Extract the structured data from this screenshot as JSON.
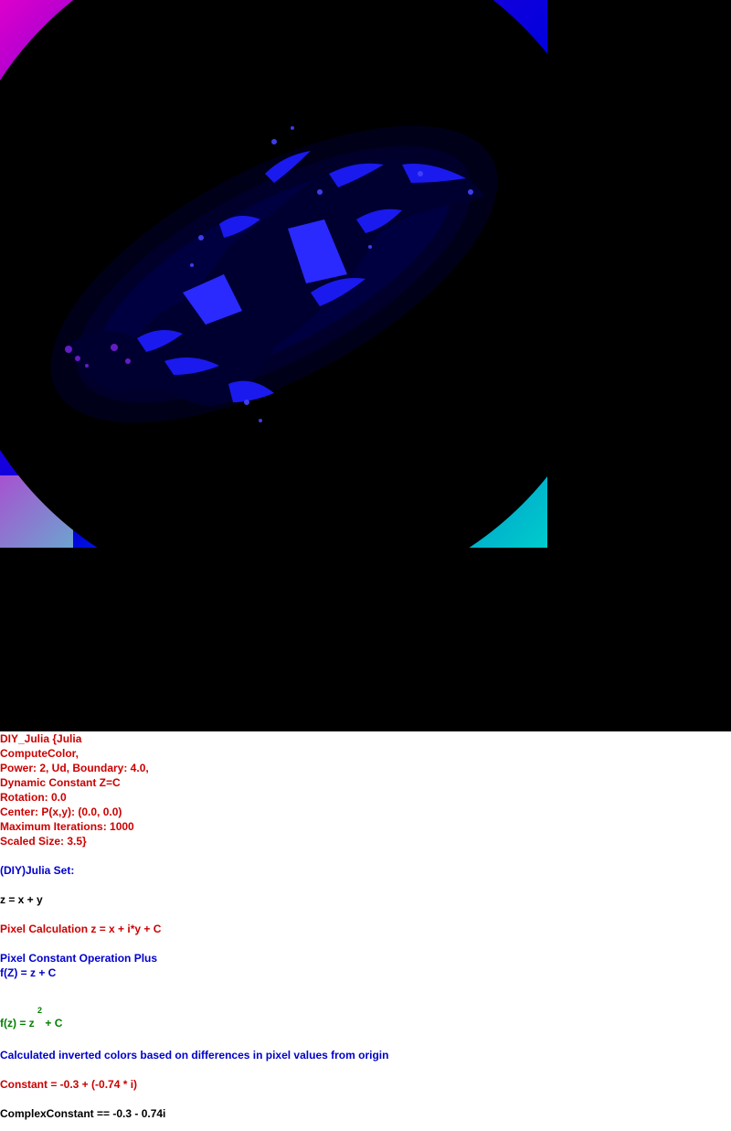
{
  "image": {
    "subject": "fractal-julia-set",
    "colors": {
      "background": "#000000",
      "magenta": "#cc00cc",
      "blue": "#0000dd",
      "cyan": "#00cccc",
      "fractal_blue": "#2222ff"
    }
  },
  "params": {
    "line1": "DIY_Julia {Julia",
    "line2": "ComputeColor,",
    "line3": "Power: 2, Ud, Boundary: 4.0,",
    "line4": "Dynamic Constant Z=C",
    "line5": "Rotation: 0.0",
    "line6": "Center: P(x,y): (0.0, 0.0)",
    "line7": "Maximum Iterations: 1000",
    "line8": "Scaled Size: 3.5}"
  },
  "set_title": "(DIY)Julia Set:",
  "z_def": "z = x + y",
  "pixel_calc": "Pixel Calculation z = x + i*y + C",
  "pixel_const_op": "Pixel Constant Operation Plus",
  "fz_plus": "f(Z) = z + C",
  "fz_main": {
    "lhs": "f(z) = z ",
    "exp": "2",
    "rhs": " + C"
  },
  "color_desc": "Calculated inverted colors based on differences in pixel values from origin",
  "constant": "Constant = -0.3 + (-0.74 * i)",
  "complex_constant": "ComplexConstant == -0.3 - 0.74i"
}
